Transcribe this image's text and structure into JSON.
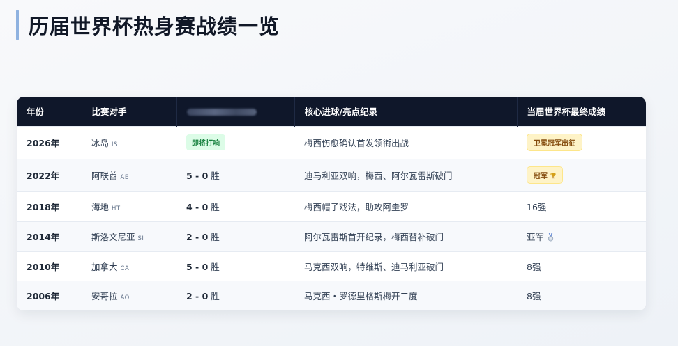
{
  "page": {
    "title": "历届世界杯热身赛战绩一览"
  },
  "table": {
    "headers": {
      "year": "年份",
      "opponent": "比赛对手",
      "highlights": "核心进球/亮点纪录",
      "final": "当届世界杯最终成绩"
    },
    "rows": [
      {
        "year": "2026年",
        "opponent": "冰岛",
        "code": "IS",
        "status": "即将打响",
        "highlight": "梅西伤愈确认首发领衔出战",
        "final_badge": "卫冕冠军出征"
      },
      {
        "year": "2022年",
        "opponent": "阿联酋",
        "code": "AE",
        "score": "5 - 0",
        "result": "胜",
        "highlight": "迪马利亚双响，梅西、阿尔瓦雷斯破门",
        "final_badge": "冠军"
      },
      {
        "year": "2018年",
        "opponent": "海地",
        "code": "HT",
        "score": "4 - 0",
        "result": "胜",
        "highlight": "梅西帽子戏法，助攻阿圭罗",
        "final": "16强"
      },
      {
        "year": "2014年",
        "opponent": "斯洛文尼亚",
        "code": "SI",
        "score": "2 - 0",
        "result": "胜",
        "highlight": "阿尔瓦雷斯首开纪录，梅西替补破门",
        "final": "亚军"
      },
      {
        "year": "2010年",
        "opponent": "加拿大",
        "code": "CA",
        "score": "5 - 0",
        "result": "胜",
        "highlight": "马克西双响，特维斯、迪马利亚破门",
        "final": "8强"
      },
      {
        "year": "2006年",
        "opponent": "安哥拉",
        "code": "AO",
        "score": "2 - 0",
        "result": "胜",
        "highlight": "马克西・罗德里格斯梅开二度",
        "final": "8强"
      }
    ]
  }
}
